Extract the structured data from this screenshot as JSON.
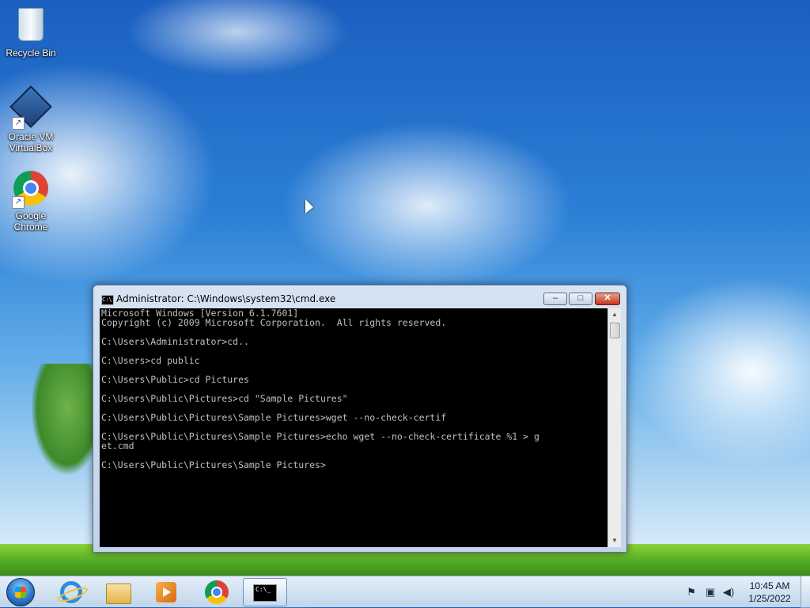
{
  "desktop": {
    "icons": [
      {
        "label": "Recycle Bin"
      },
      {
        "label": "Oracle VM VirtualBox"
      },
      {
        "label": "Google Chrome"
      }
    ]
  },
  "cmd_window": {
    "title": "Administrator: C:\\Windows\\system32\\cmd.exe",
    "title_icon_text": "C:\\",
    "buttons": {
      "minimize": "–",
      "maximize": "□",
      "close": "✕"
    },
    "lines": [
      "Microsoft Windows [Version 6.1.7601]",
      "Copyright (c) 2009 Microsoft Corporation.  All rights reserved.",
      "",
      "C:\\Users\\Administrator>cd..",
      "",
      "C:\\Users>cd public",
      "",
      "C:\\Users\\Public>cd Pictures",
      "",
      "C:\\Users\\Public\\Pictures>cd \"Sample Pictures\"",
      "",
      "C:\\Users\\Public\\Pictures\\Sample Pictures>wget --no-check-certif",
      "",
      "C:\\Users\\Public\\Pictures\\Sample Pictures>echo wget --no-check-certificate %1 > g",
      "et.cmd",
      "",
      "C:\\Users\\Public\\Pictures\\Sample Pictures>"
    ],
    "scroll_up": "▲",
    "scroll_down": "▼"
  },
  "taskbar": {
    "items": [
      {
        "icon": "internet-explorer-icon"
      },
      {
        "icon": "file-explorer-icon"
      },
      {
        "icon": "media-player-icon"
      },
      {
        "icon": "chrome-icon"
      },
      {
        "icon": "command-prompt-icon",
        "label": "C:\\_",
        "active": true
      }
    ],
    "tray": {
      "flag": "⚑",
      "network": "▣",
      "volume": "◀)"
    },
    "clock": {
      "time": "10:45 AM",
      "date": "1/25/2022"
    }
  }
}
